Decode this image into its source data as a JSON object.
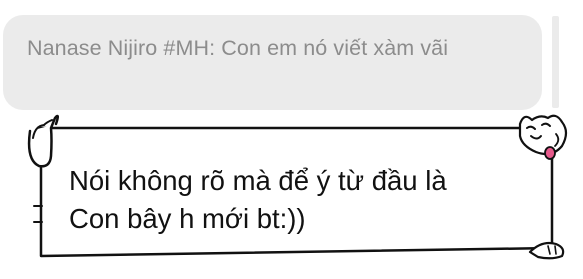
{
  "quoted_message": {
    "text": "Nanase Nijiro #MH: Con em nó viết xàm vãi"
  },
  "message": {
    "line1": "Nói không rõ mà để ý từ đầu là",
    "line2": "Con bây h mới bt:))"
  },
  "icons": {
    "frame_decoration": "cat-sticker-frame-icon"
  },
  "colors": {
    "quoted_bubble_bg": "#ebebeb",
    "quoted_text": "#8c8c8c",
    "message_text": "#111111",
    "outline": "#111111",
    "tongue": "#e75a8c"
  }
}
